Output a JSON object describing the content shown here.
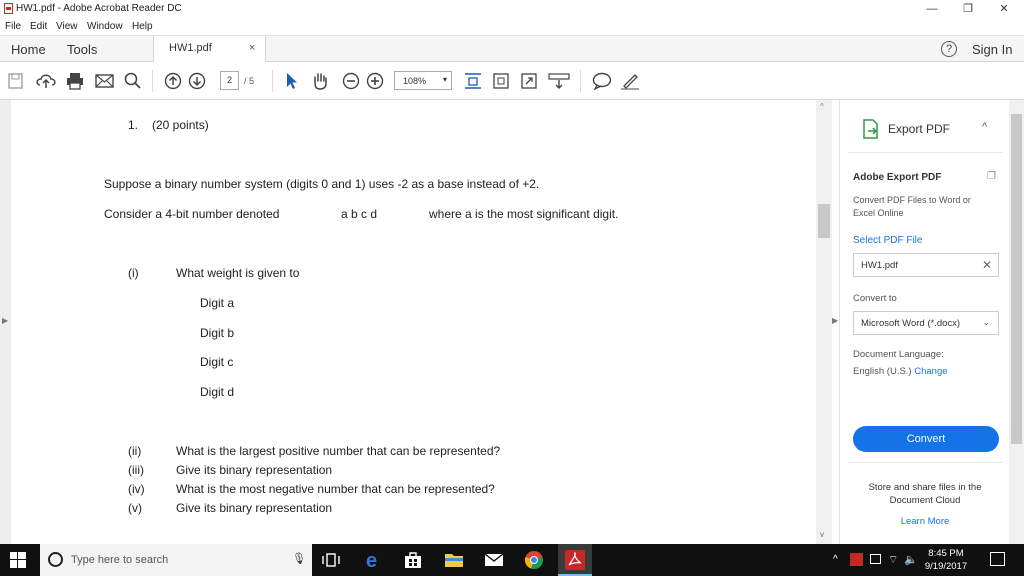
{
  "window": {
    "title": "HW1.pdf - Adobe Acrobat Reader DC",
    "minimize": "—",
    "restore": "❐",
    "close": "✕"
  },
  "menu": [
    "File",
    "Edit",
    "View",
    "Window",
    "Help"
  ],
  "tabs": {
    "home": "Home",
    "tools": "Tools",
    "document": "HW1.pdf",
    "close": "×",
    "help": "?",
    "sign_in": "Sign In"
  },
  "toolbar": {
    "page_current": "2",
    "page_total": "/ 5",
    "zoom": "108%",
    "zoom_caret": "▾"
  },
  "document": {
    "q_number": "1.",
    "q_points": "(20 points)",
    "intro": "Suppose a binary number system (digits 0 and 1) uses -2 as a base instead of +2.",
    "consider": "Consider a 4-bit number denoted",
    "digits": "a b c d",
    "msd": "where a is the most significant digit.",
    "part_i_label": "(i)",
    "part_i_text": "What weight is given to",
    "digit_a": "Digit a",
    "digit_b": "Digit b",
    "digit_c": "Digit c",
    "digit_d": "Digit d",
    "parts": [
      {
        "label": "(ii)",
        "text": "What is the largest positive number that can be represented?"
      },
      {
        "label": "(iii)",
        "text": "Give its binary representation"
      },
      {
        "label": "(iv)",
        "text": "What is the most negative number that can be represented?"
      },
      {
        "label": "(v)",
        "text": "Give its binary representation"
      }
    ]
  },
  "right_pane": {
    "export_title": "Export PDF",
    "chevron": "^",
    "section_title": "Adobe Export PDF",
    "description": "Convert PDF Files to Word or Excel Online",
    "select_file": "Select PDF File",
    "file_value": "HW1.pdf",
    "file_clear": "✕",
    "convert_to": "Convert to",
    "format_value": "Microsoft Word (*.docx)",
    "format_caret": "⌄",
    "doc_language": "Document Language:",
    "language_value": "English (U.S.)",
    "language_change": "Change",
    "convert_button": "Convert",
    "store_text": "Store and share files in the Document Cloud",
    "learn_more": "Learn More"
  },
  "taskbar": {
    "search_placeholder": "Type here to search",
    "time": "8:45 PM",
    "date": "9/19/2017"
  },
  "colors": {
    "accent": "#1473e6",
    "acrobat_red": "#c62828",
    "taskbar": "#101010"
  }
}
